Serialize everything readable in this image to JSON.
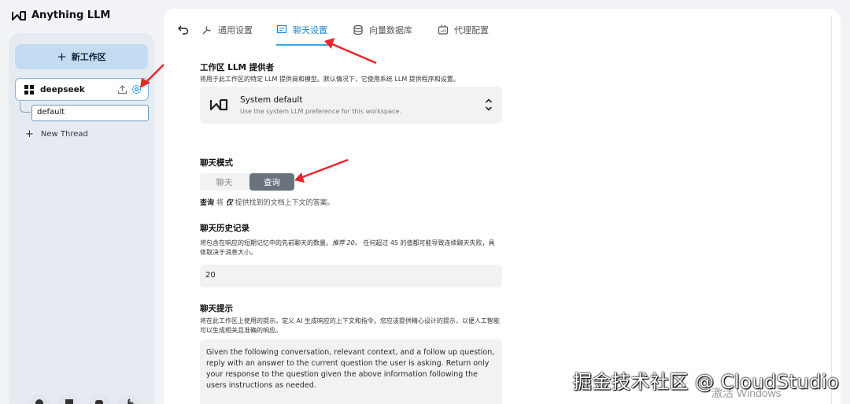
{
  "app": {
    "name": "Anything LLM"
  },
  "sidebar": {
    "new_workspace_label": "新工作区",
    "workspace": {
      "name": "deepseek"
    },
    "thread": {
      "name": "default"
    },
    "new_thread_label": "New Thread"
  },
  "tabs": [
    {
      "label": "通用设置",
      "icon": "wrench-icon",
      "active": false
    },
    {
      "label": "聊天设置",
      "icon": "chat-icon",
      "active": true
    },
    {
      "label": "向量数据库",
      "icon": "database-icon",
      "active": false
    },
    {
      "label": "代理配置",
      "icon": "agent-icon",
      "active": false
    }
  ],
  "llm_provider": {
    "title": "工作区 LLM 提供者",
    "description": "将用于此工作区的特定 LLM 提供商和模型。默认情况下，它使用系统 LLM 提供程序和设置。",
    "selected_name": "System default",
    "selected_description": "Use the system LLM preference for this workspace."
  },
  "chat_mode": {
    "title": "聊天模式",
    "options": [
      "聊天",
      "查询"
    ],
    "selected": "查询",
    "hint_bold": "查询",
    "hint_rest": " 将 ",
    "hint_italic": "仅",
    "hint_tail": " 提供找到的文档上下文的答案。"
  },
  "chat_history": {
    "title": "聊天历史记录",
    "description_1": "将包含在响应的短期记忆中的先前聊天的数量。",
    "recommend": "推荐 20。",
    "description_2": " 任何超过 45 的值都可能导致连续聊天失败，具体取决于消息大小。",
    "value": "20"
  },
  "chat_prompt": {
    "title": "聊天提示",
    "description": "将在此工作区上使用的提示。定义 AI 生成响应的上下文和指令。您应该提供精心设计的提示，以便人工智能可以生成相关且准确的响应。",
    "value": "Given the following conversation, relevant context, and a follow up question, reply with an answer to the current question the user is asking. Return only your response to the question given the above information following the users instructions as needed."
  },
  "watermarks": {
    "windows": "激活 Windows",
    "site": "掘金技术社区 @ CloudStudio"
  },
  "colors": {
    "accent": "#1e86d6",
    "annotation_arrow": "#e8262a",
    "new_workspace_bg": "#c4dcf2",
    "active_mode_bg": "#6a737d"
  }
}
